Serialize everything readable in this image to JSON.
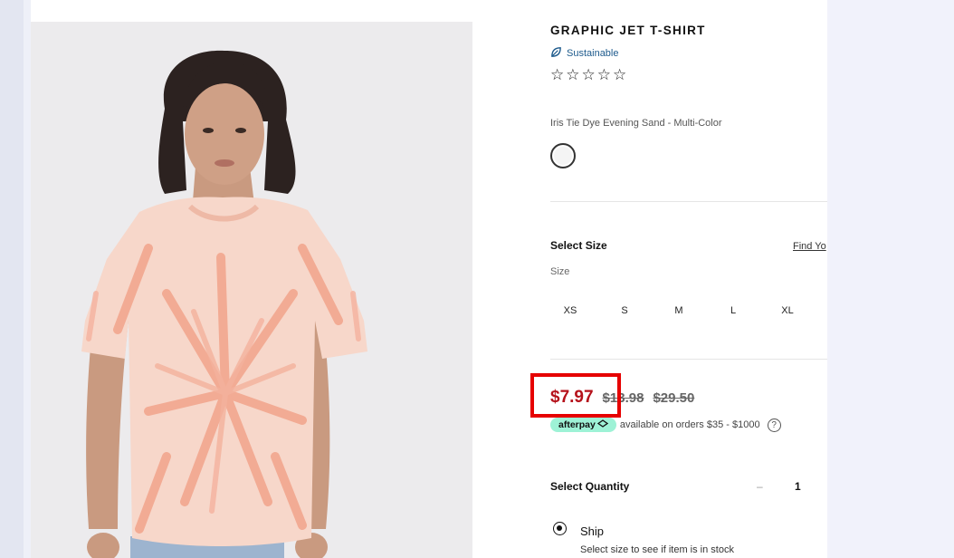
{
  "product": {
    "title": "GRAPHIC JET T-SHIRT",
    "sustainable_label": "Sustainable",
    "stars": [
      "☆",
      "☆",
      "☆",
      "☆",
      "☆"
    ],
    "color_name": "Iris Tie Dye Evening Sand - Multi-Color"
  },
  "size": {
    "title": "Select Size",
    "find_link": "Find Yo",
    "label": "Size",
    "options": [
      "XS",
      "S",
      "M",
      "L",
      "XL"
    ]
  },
  "price": {
    "current": "$7.97",
    "was": "$13.98",
    "original": "$29.50"
  },
  "afterpay": {
    "badge": "afterpay",
    "text": "available on orders $35 - $1000",
    "help": "?"
  },
  "quantity": {
    "title": "Select Quantity",
    "minus": "–",
    "value": "1"
  },
  "fulfillment": {
    "ship_label": "Ship",
    "ship_note": "Select size to see if item is in stock"
  },
  "colors": {
    "price_red": "#b5121b",
    "highlight": "#e60000",
    "afterpay_mint": "#9ef2d6",
    "sustain_blue": "#1d5a8c"
  }
}
